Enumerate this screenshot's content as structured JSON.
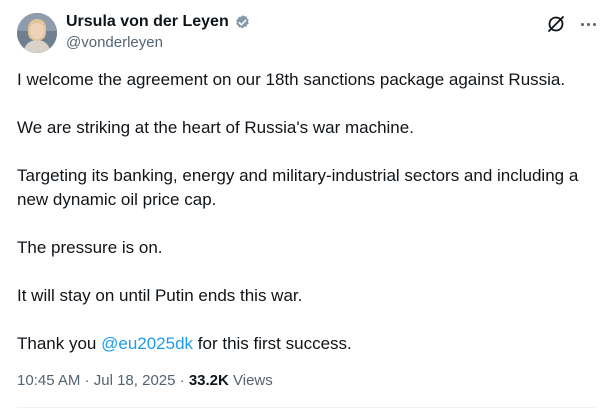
{
  "author": {
    "display_name": "Ursula von der Leyen",
    "handle": "@vonderleyen",
    "verified_color": "#829aab",
    "avatar_icon": "profile-photo"
  },
  "actions": {
    "grok_icon": "grok-icon",
    "more_icon": "more-dots-icon"
  },
  "tweet": {
    "paragraphs": [
      "I welcome the agreement on our 18th sanctions package against Russia.",
      "We are striking at the heart of Russia's war machine.",
      "Targeting its banking, energy and military-industrial sectors and including a new dynamic oil price cap.",
      "The pressure is on.",
      "It will stay on until Putin ends this war."
    ],
    "last_prefix": "Thank you ",
    "mention": "@eu2025dk",
    "last_suffix": " for this first success."
  },
  "meta": {
    "time": "10:45 AM",
    "separator1": " · ",
    "date": "Jul 18, 2025",
    "separator2": " · ",
    "views_count": "33.2K",
    "views_label": " Views"
  },
  "colors": {
    "accent": "#1d9bf0",
    "secondary_text": "#536471",
    "primary_text": "#0f1419"
  }
}
